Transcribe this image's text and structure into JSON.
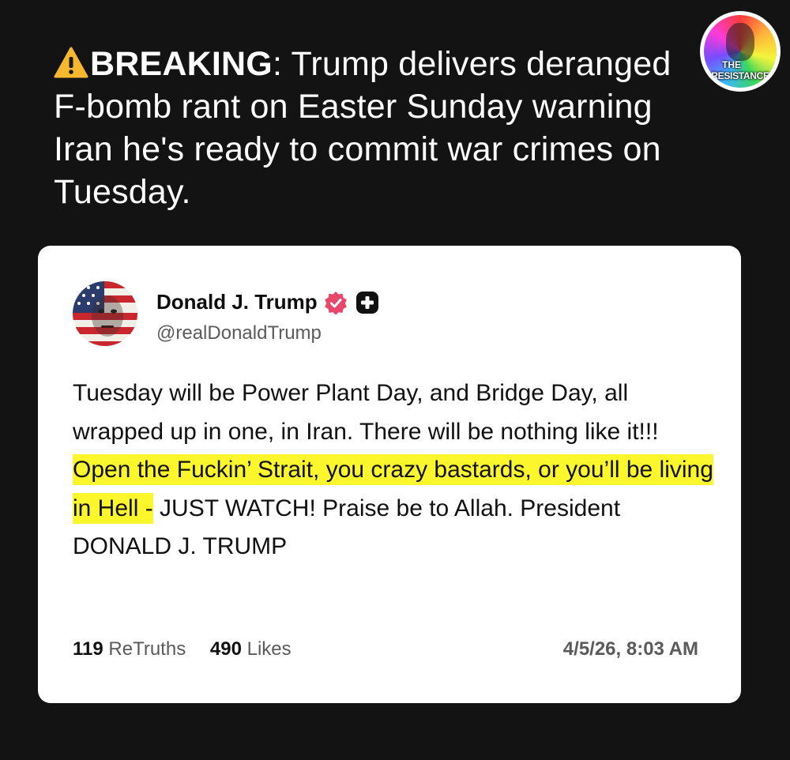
{
  "headline": {
    "icon": "warning-icon",
    "breaking_label": "BREAKING",
    "text": ": Trump delivers deranged F-bomb rant on Easter Sunday warning Iran he's ready to commit war crimes on Tuesday."
  },
  "badge": {
    "line1": "THE",
    "line2": "RESISTANCE"
  },
  "post": {
    "author_name": "Donald J. Trump",
    "handle": "@realDonaldTrump",
    "verified_icon": "verified-badge-icon",
    "plus_icon": "plus-badge-icon",
    "text_before": "Tuesday will be Power Plant Day, and Bridge Day, all wrapped up in one, in Iran. There will be nothing like it!!!",
    "text_highlight": " Open the Fuckin’ Strait, you crazy bastards, or you’ll be living in Hell -",
    "text_after": " JUST WATCH! Praise be to Allah. President DONALD J. TRUMP",
    "retruths_count": "119",
    "retruths_label": "ReTruths",
    "likes_count": "490",
    "likes_label": "Likes",
    "timestamp": "4/5/26, 8:03 AM"
  },
  "colors": {
    "background": "#131313",
    "card": "#ffffff",
    "highlight": "#fcf72d",
    "warning": "#f5b82e",
    "verified": "#e8476c"
  }
}
